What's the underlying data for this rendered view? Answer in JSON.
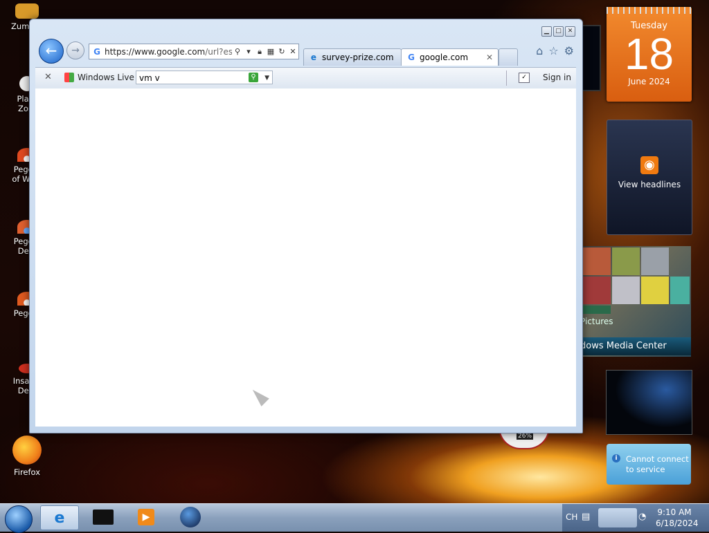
{
  "desktop": {
    "icons": [
      {
        "label": "Zuma D",
        "color": "#d89a2a"
      },
      {
        "label": "Plant\nZom",
        "color": "#8ac63a"
      },
      {
        "label": "Peggle\nof Warc",
        "color": "#e04a20"
      },
      {
        "label": "Peggle\nDelu",
        "color": "#e06030"
      },
      {
        "label": "Peggle",
        "color": "#e05a20"
      },
      {
        "label": "Insanic\nDelu",
        "color": "#d03020"
      },
      {
        "label": "Firefox",
        "color": "#f0801a"
      }
    ]
  },
  "gadgets": {
    "calendar": {
      "weekday": "Tuesday",
      "day": "18",
      "month_year": "June 2024"
    },
    "feeds": {
      "label": "View headlines"
    },
    "media_center": {
      "pictures_label": "Pictures",
      "title": "dows Media Center"
    },
    "notice": {
      "text": "Cannot connect to service"
    },
    "gauge": {
      "value": "26%"
    }
  },
  "browser": {
    "address": {
      "scheme_host": "https://www.google.com",
      "path": "/url?esr"
    },
    "tabs": [
      {
        "label": "survey-prize.com",
        "icon": "ie-icon"
      },
      {
        "label": "google.com",
        "icon": "google-icon"
      }
    ],
    "toolbar": {
      "windows_live_label": "Windows Live",
      "search_value": "vm v",
      "sign_in_label": "Sign in"
    }
  },
  "taskbar": {
    "language": "CH",
    "time": "9:10 AM",
    "date": "6/18/2024"
  }
}
